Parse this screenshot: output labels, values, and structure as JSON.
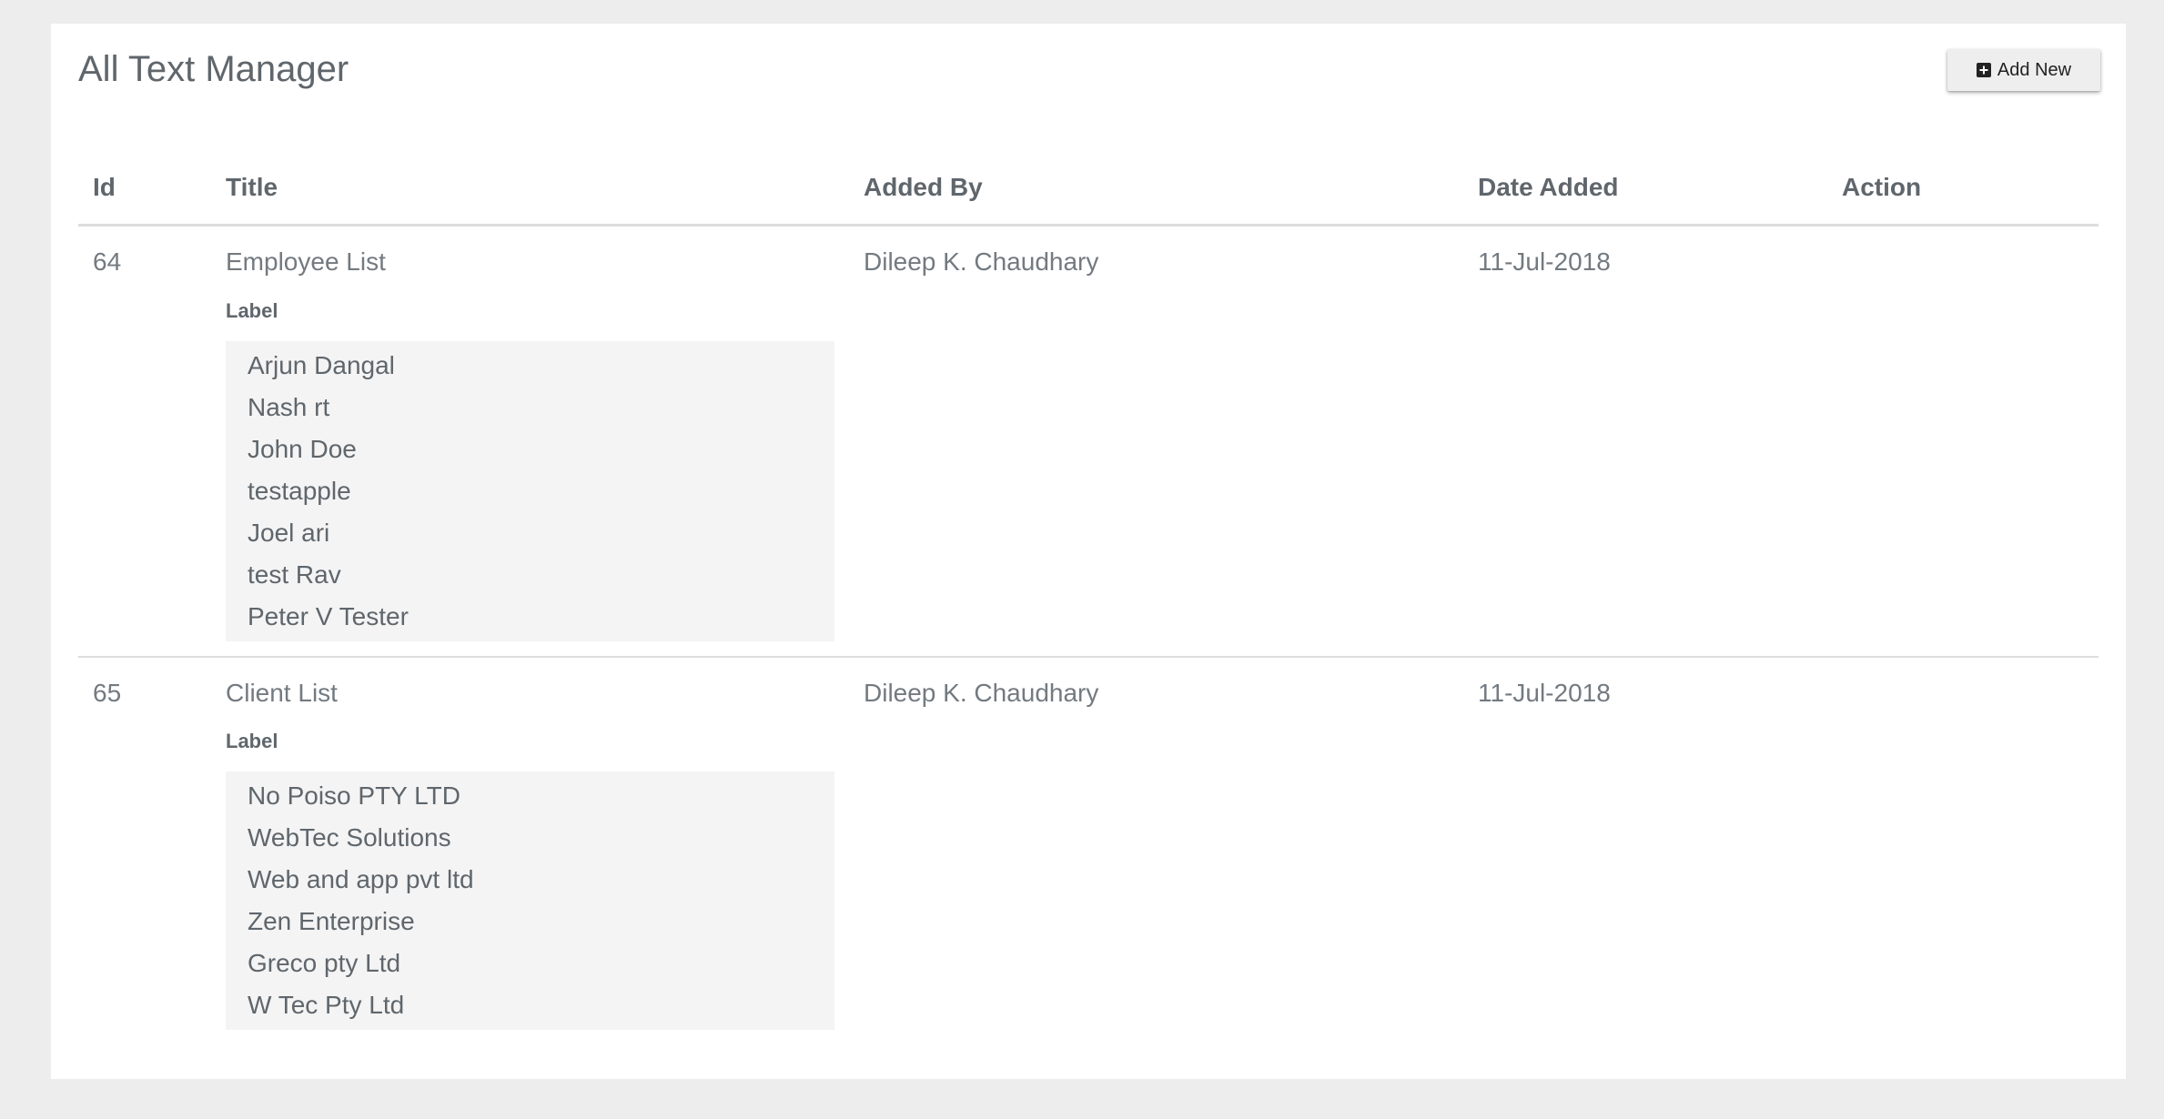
{
  "page": {
    "title": "All Text Manager",
    "add_new_label": "Add New"
  },
  "table": {
    "headers": {
      "id": "Id",
      "title": "Title",
      "added_by": "Added By",
      "date_added": "Date Added",
      "action": "Action"
    },
    "rows": [
      {
        "id": "64",
        "title": "Employee List",
        "label_heading": "Label",
        "labels": [
          "Arjun Dangal",
          "Nash rt",
          "John Doe",
          "testapple",
          "Joel ari",
          "test Rav",
          "Peter V Tester"
        ],
        "added_by": "Dileep K. Chaudhary",
        "date_added": "11-Jul-2018"
      },
      {
        "id": "65",
        "title": "Client List",
        "label_heading": "Label",
        "labels": [
          "No Poiso PTY LTD",
          "WebTec Solutions",
          "Web and app pvt ltd",
          "Zen Enterprise",
          "Greco pty Ltd",
          "W Tec Pty Ltd"
        ],
        "added_by": "Dileep K. Chaudhary",
        "date_added": "11-Jul-2018"
      }
    ]
  },
  "colors": {
    "background": "#ededed",
    "panel": "#ffffff",
    "text": "#636a70",
    "label_box": "#f4f4f4",
    "divider": "#dddddd"
  },
  "icons": {
    "add_new": "plus-square-icon"
  }
}
